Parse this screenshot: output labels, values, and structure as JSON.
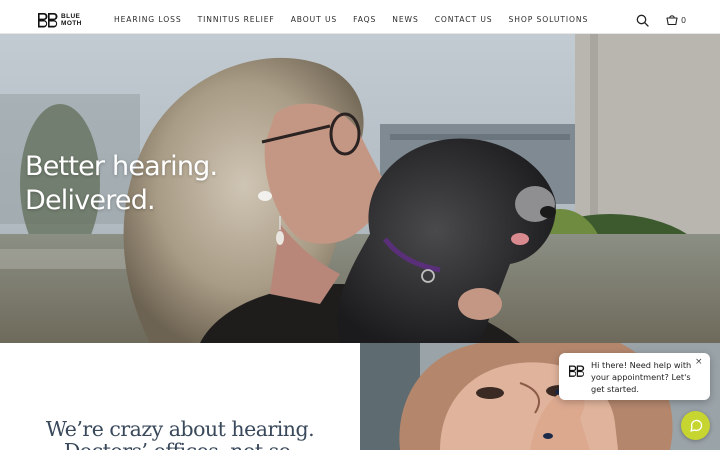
{
  "brand": {
    "name_line1": "BLUE",
    "name_line2": "MOTH"
  },
  "nav": {
    "items": [
      {
        "label": "HEARING LOSS"
      },
      {
        "label": "TINNITUS RELIEF"
      },
      {
        "label": "ABOUT US"
      },
      {
        "label": "FAQS"
      },
      {
        "label": "NEWS"
      },
      {
        "label": "CONTACT US"
      },
      {
        "label": "SHOP SOLUTIONS"
      }
    ],
    "cart_count": "0",
    "icons": {
      "search": "search-icon",
      "cart": "cart-icon"
    }
  },
  "hero": {
    "line1": "Better hearing.",
    "line2": "Delivered."
  },
  "section": {
    "line1": "We’re crazy about hearing.",
    "line2": "Doctors’ offices, not so."
  },
  "chat": {
    "message": "Hi there! Need help with your appointment? Let's get started.",
    "close_label": "×",
    "launcher_icon": "chat-icon"
  },
  "colors": {
    "accent": "#c6d52f",
    "heading": "#39495b"
  }
}
